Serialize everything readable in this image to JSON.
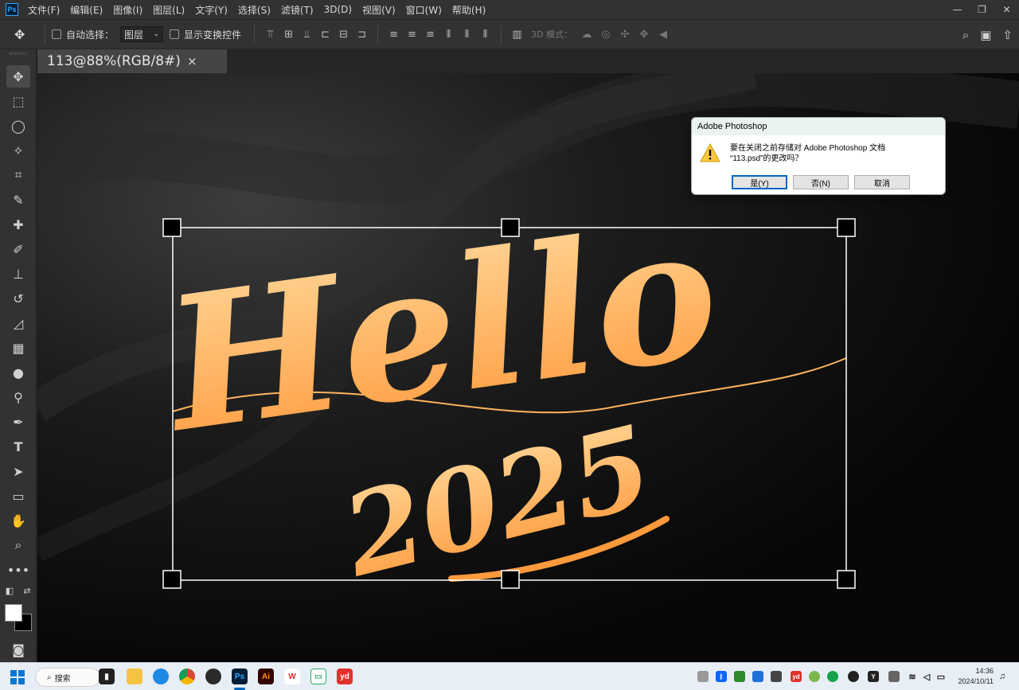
{
  "app": {
    "logo": "Ps"
  },
  "menu": [
    "文件(F)",
    "编辑(E)",
    "图像(I)",
    "图层(L)",
    "文字(Y)",
    "选择(S)",
    "滤镜(T)",
    "3D(D)",
    "视图(V)",
    "窗口(W)",
    "帮助(H)"
  ],
  "options": {
    "auto_select_label": "自动选择：",
    "layer_select_value": "图层",
    "show_transform_label": "显示变换控件",
    "mode_3d_label": "3D 模式："
  },
  "document": {
    "tab_title": "113@88%(RGB/8#)"
  },
  "dialog": {
    "title": "Adobe Photoshop",
    "message_line1": "要在关闭之前存储对 Adobe Photoshop 文档",
    "message_line2": "“113.psd”的更改吗？",
    "yes_label": "是(Y)",
    "no_label": "否(N)",
    "cancel_label": "取消"
  },
  "canvas_art": {
    "text_main": "Hello",
    "text_year": "2025",
    "gradient_top": "#ffd89a",
    "gradient_bottom": "#ff9a3c"
  },
  "taskbar": {
    "search_label": "搜索",
    "time": "14:36",
    "date": "2024/10/11"
  },
  "colors": {
    "ui_bg": "#323232",
    "canvas_bg": "#0d0d0d",
    "accent": "#0067c0"
  }
}
